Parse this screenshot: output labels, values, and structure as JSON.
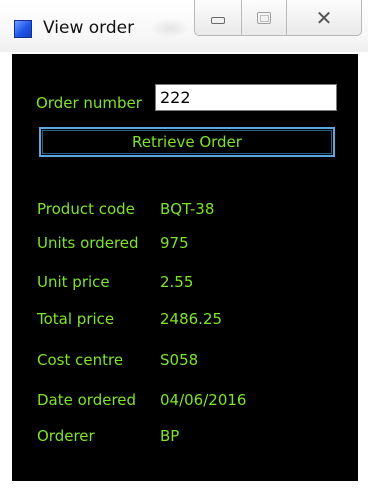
{
  "window": {
    "title": "View order",
    "close_glyph": "✕"
  },
  "icons": {
    "app": "app-window-icon",
    "minimize": "minimize-icon",
    "maximize": "maximize-icon",
    "close": "close-icon"
  },
  "form": {
    "order_number_label": "Order number",
    "order_number_value": "222",
    "retrieve_label": "Retrieve Order"
  },
  "details": {
    "product_code_label": "Product code",
    "product_code_value": "BQT-38",
    "units_ordered_label": "Units ordered",
    "units_ordered_value": "975",
    "unit_price_label": "Unit price",
    "unit_price_value": "2.55",
    "total_price_label": "Total price",
    "total_price_value": "2486.25",
    "cost_centre_label": "Cost centre",
    "cost_centre_value": "S058",
    "date_ordered_label": "Date ordered",
    "date_ordered_value": "04/06/2016",
    "orderer_label": "Orderer",
    "orderer_value": "BP"
  },
  "colors": {
    "background": "#000000",
    "text": "#7ee32a",
    "button_border": "#5ba8e0"
  }
}
